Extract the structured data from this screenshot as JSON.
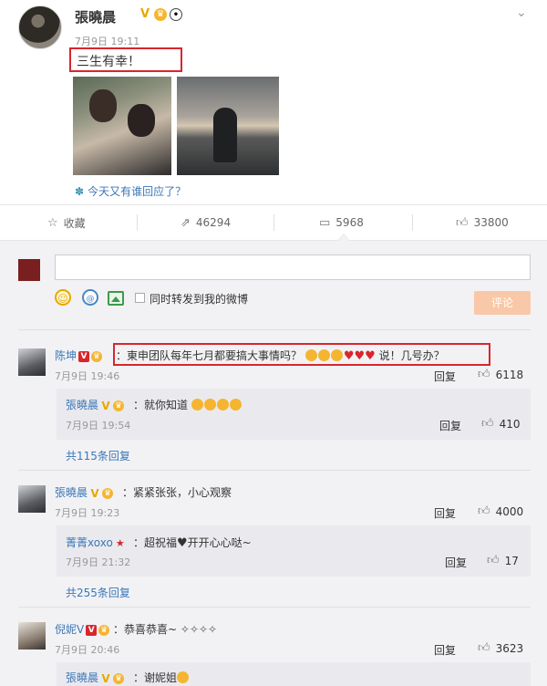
{
  "post": {
    "author": "張曉晨",
    "time": "7月9日 19:11",
    "text": "三生有幸！",
    "topic": "今天又有谁回应了？"
  },
  "actions": {
    "favorite": "收藏",
    "repost": "46294",
    "comment": "5968",
    "like": "33800"
  },
  "composer": {
    "input_value": "",
    "repost_label": "同时转发到我的微博",
    "submit_label": "评论"
  },
  "comments": [
    {
      "name": "陈坤",
      "text_prefix": "：",
      "text": "東申团队每年七月都要搞大事情吗？",
      "text_suffix": "说！几号办？",
      "time": "7月9日 19:46",
      "reply": "回复",
      "likes": "6118",
      "sub": {
        "name": "張曉晨",
        "text": "：就你知道",
        "time": "7月9日 19:54",
        "reply": "回复",
        "likes": "410"
      },
      "more": "共115条回复"
    },
    {
      "name": "張曉晨",
      "text": "：紧紧张张，小心观察",
      "time": "7月9日 19:23",
      "reply": "回复",
      "likes": "4000",
      "sub": {
        "name": "菁菁xoxo",
        "text": "：超祝福",
        "text_tail": "开开心心哒~",
        "time": "7月9日 21:32",
        "reply": "回复",
        "likes": "17"
      },
      "more": "共255条回复"
    },
    {
      "name": "倪妮V",
      "text": "：恭喜恭喜~",
      "time": "7月9日 20:46",
      "reply": "回复",
      "likes": "3623",
      "sub": {
        "name": "張曉晨",
        "text": "：谢妮姐"
      }
    }
  ]
}
